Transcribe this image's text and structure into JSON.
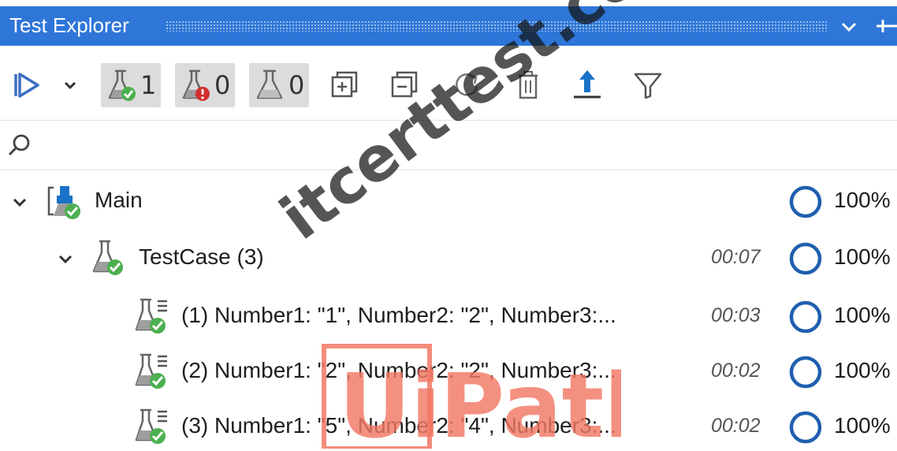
{
  "window": {
    "title": "Test Explorer"
  },
  "toolbar": {
    "passed_count": "1",
    "failed_count": "0",
    "not_run_count": "0"
  },
  "search": {
    "value": "",
    "placeholder": ""
  },
  "tree": {
    "root": {
      "label": "Main",
      "coverage": "100%"
    },
    "test_case": {
      "label": "TestCase (3)",
      "duration": "00:07",
      "coverage": "100%"
    },
    "variations": [
      {
        "label": "(1) Number1: \"1\", Number2: \"2\", Number3:...",
        "duration": "00:03",
        "coverage": "100%"
      },
      {
        "label": "(2) Number1: \"2\", Number2: \"2\", Number3:...",
        "duration": "00:02",
        "coverage": "100%"
      },
      {
        "label": "(3) Number1: \"5\", Number2: \"4\", Number3:...",
        "duration": "00:02",
        "coverage": "100%"
      }
    ]
  },
  "watermark": {
    "site": "itcerttest.com",
    "logo": "UiPath"
  },
  "colors": {
    "title_bar": "#2e76d8",
    "pass_green": "#4caf50",
    "fail_red": "#d32f2f",
    "coverage_ring": "#1f5fae",
    "accent_blue": "#1a73c8",
    "logo_red": "#f27864"
  }
}
